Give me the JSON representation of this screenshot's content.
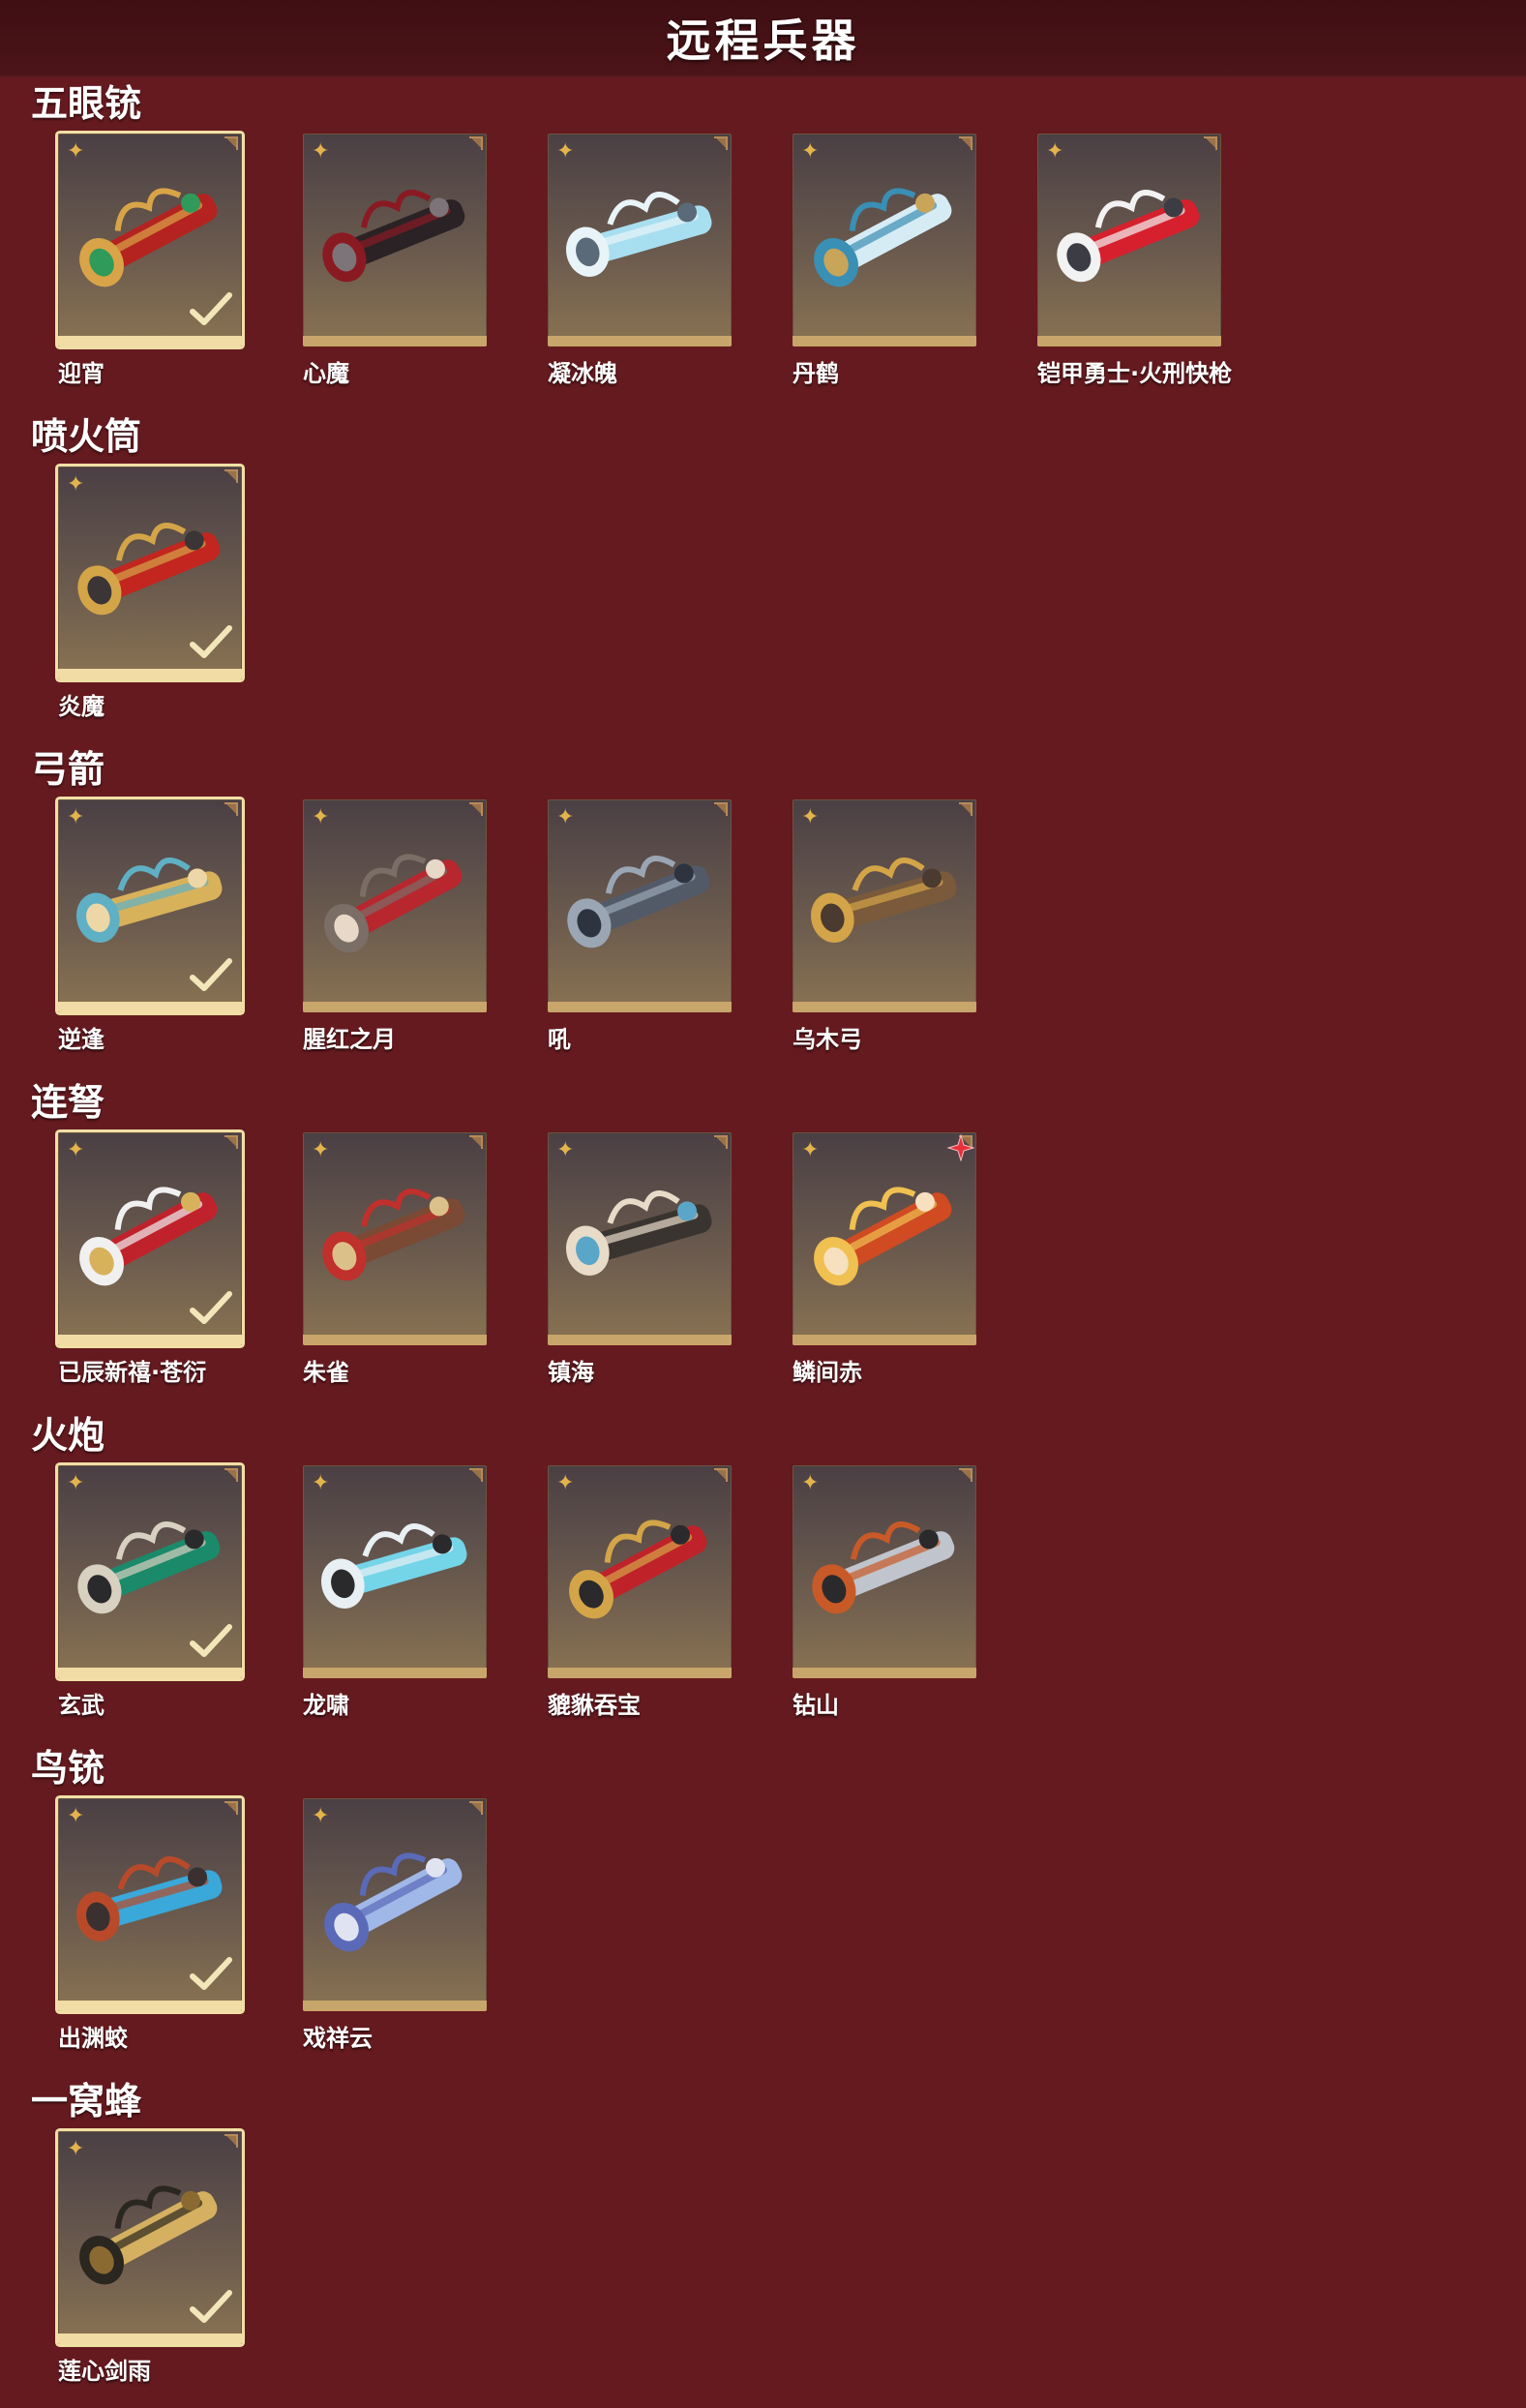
{
  "page_title": "远程兵器",
  "sections": [
    {
      "title": "五眼铳",
      "items": [
        {
          "name": "迎宵",
          "selected": true,
          "colors": [
            "#b4231f",
            "#d8a447",
            "#2f9a5a"
          ]
        },
        {
          "name": "心魔",
          "selected": false,
          "colors": [
            "#2a2225",
            "#8a1a22",
            "#7c7478"
          ]
        },
        {
          "name": "凝冰魄",
          "selected": false,
          "colors": [
            "#a8dff0",
            "#e8f4f8",
            "#5a6a78"
          ]
        },
        {
          "name": "丹鹤",
          "selected": false,
          "colors": [
            "#d6ecf4",
            "#3a8fb4",
            "#c9a55a"
          ]
        },
        {
          "name": "铠甲勇士·火刑快枪",
          "selected": false,
          "colors": [
            "#d6202e",
            "#f2f2f2",
            "#3c3c44"
          ]
        }
      ]
    },
    {
      "title": "喷火筒",
      "items": [
        {
          "name": "炎魔",
          "selected": true,
          "colors": [
            "#c2261f",
            "#d4a448",
            "#3b3536"
          ]
        }
      ]
    },
    {
      "title": "弓箭",
      "items": [
        {
          "name": "逆逢",
          "selected": true,
          "colors": [
            "#d8b25a",
            "#5fb0c4",
            "#eed7a6"
          ]
        },
        {
          "name": "腥红之月",
          "selected": false,
          "colors": [
            "#b8262e",
            "#7a6e66",
            "#e8d8c8"
          ]
        },
        {
          "name": "吼",
          "selected": false,
          "colors": [
            "#525a68",
            "#9aa6b4",
            "#2d3440"
          ]
        },
        {
          "name": "乌木弓",
          "selected": false,
          "colors": [
            "#7a5a3a",
            "#d4a448",
            "#4a3a30"
          ]
        }
      ]
    },
    {
      "title": "连弩",
      "items": [
        {
          "name": "已辰新禧·苍衍",
          "selected": true,
          "colors": [
            "#c0222c",
            "#f0f0f0",
            "#d8b25a"
          ]
        },
        {
          "name": "朱雀",
          "selected": false,
          "colors": [
            "#7a4a34",
            "#c0302c",
            "#dcc08a"
          ]
        },
        {
          "name": "镇海",
          "selected": false,
          "colors": [
            "#3a3430",
            "#e8dcc8",
            "#5aa6c8"
          ]
        },
        {
          "name": "鳞间赤",
          "selected": false,
          "colors": [
            "#d04a22",
            "#f0c050",
            "#f6e0c0"
          ]
        }
      ]
    },
    {
      "title": "火炮",
      "items": [
        {
          "name": "玄武",
          "selected": true,
          "colors": [
            "#1a8a6a",
            "#d8d0c0",
            "#2a2a2c"
          ]
        },
        {
          "name": "龙啸",
          "selected": false,
          "colors": [
            "#74d4e8",
            "#e8f0f4",
            "#2a2a2c"
          ]
        },
        {
          "name": "貔貅吞宝",
          "selected": false,
          "colors": [
            "#c0222a",
            "#d4a448",
            "#2a2a2c"
          ]
        },
        {
          "name": "钻山",
          "selected": false,
          "colors": [
            "#c0c4cc",
            "#c85a28",
            "#2a2a2c"
          ]
        }
      ]
    },
    {
      "title": "鸟铳",
      "items": [
        {
          "name": "出渊蛟",
          "selected": true,
          "colors": [
            "#3aa8d8",
            "#b84a2a",
            "#3a3030"
          ]
        },
        {
          "name": "戏祥云",
          "selected": false,
          "colors": [
            "#a0b8e8",
            "#5a6ab8",
            "#e0e4f0"
          ]
        }
      ]
    },
    {
      "title": "一窝蜂",
      "items": [
        {
          "name": "莲心剑雨",
          "selected": true,
          "colors": [
            "#d4b060",
            "#2a2620",
            "#8a6a30"
          ]
        }
      ]
    }
  ],
  "new_badge_item": "鳞间赤",
  "icons": {
    "rarity": "rarity-star-icon",
    "selected": "check-icon",
    "new": "new-badge-icon",
    "corner": "corner-mark-icon"
  }
}
